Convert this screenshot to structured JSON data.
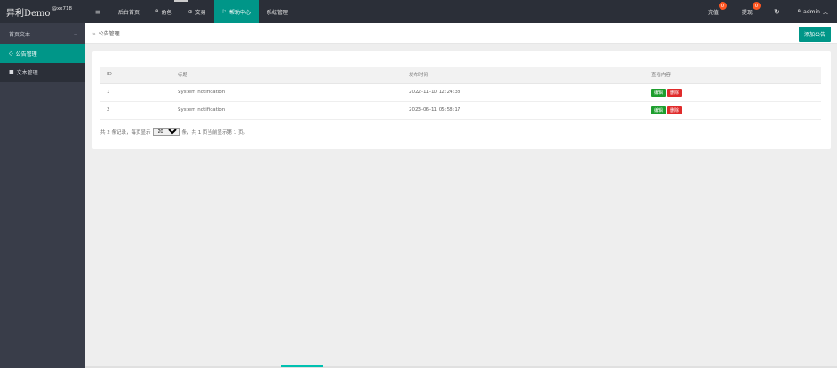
{
  "app": {
    "logo": "异利Demo",
    "logo_sup": "@xx718"
  },
  "sidebar": {
    "group_label": "首页文本",
    "items": [
      {
        "label": "公告管理",
        "icon": "diamond-icon"
      },
      {
        "label": "文本管理",
        "icon": "book-icon"
      }
    ]
  },
  "header": {
    "nav": [
      {
        "label": "后台首页"
      },
      {
        "label": "角色",
        "icon": "user-icon"
      },
      {
        "label": "交易",
        "icon": "globe-icon"
      },
      {
        "label": "帮助中心",
        "icon": "flag-icon"
      },
      {
        "label": "系统管理"
      }
    ],
    "recharge_label": "充值",
    "recharge_count": "0",
    "withdraw_label": "提现",
    "withdraw_count": "0",
    "user_label": "admin"
  },
  "breadcrumb": {
    "current": "公告管理"
  },
  "actions": {
    "add_label": "添加公告"
  },
  "table": {
    "columns": [
      "ID",
      "标题",
      "发布时间",
      "查看内容"
    ],
    "rows": [
      {
        "id": "1",
        "title": "System notification",
        "time": "2022-11-10 12:24:38",
        "edit": "编辑",
        "delete": "删除"
      },
      {
        "id": "2",
        "title": "System notification",
        "time": "2023-06-11 05:58:17",
        "edit": "编辑",
        "delete": "删除"
      }
    ]
  },
  "pager": {
    "prefix": "共 2 条记录，每页显示",
    "page_size": "20",
    "suffix": "条，共 1 页当前显示第 1 页。"
  },
  "colors": {
    "accent": "#009688",
    "sidebar_bg": "#393d49",
    "header_bg": "#2b2f38",
    "badge": "#ff5722",
    "edit_btn": "#1e9e2e",
    "delete_btn": "#e02b2b"
  }
}
